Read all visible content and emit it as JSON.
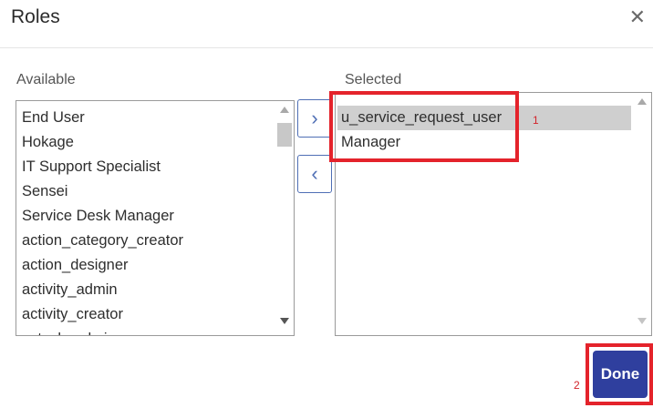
{
  "dialog": {
    "title": "Roles",
    "close_icon": "close-icon"
  },
  "available": {
    "label": "Available",
    "items": [
      "End User",
      "Hokage",
      "IT Support Specialist",
      "Sensei",
      "Service Desk Manager",
      "action_category_creator",
      "action_designer",
      "activity_admin",
      "activity_creator",
      "actsub_admin"
    ]
  },
  "selected": {
    "label": "Selected",
    "items": [
      "u_service_request_user",
      "Manager"
    ]
  },
  "buttons": {
    "move_right_icon": "chevron-right-icon",
    "move_left_icon": "chevron-left-icon",
    "done_label": "Done"
  },
  "annotations": {
    "marker_1": "1",
    "marker_2": "2",
    "color": "#e4232b"
  }
}
